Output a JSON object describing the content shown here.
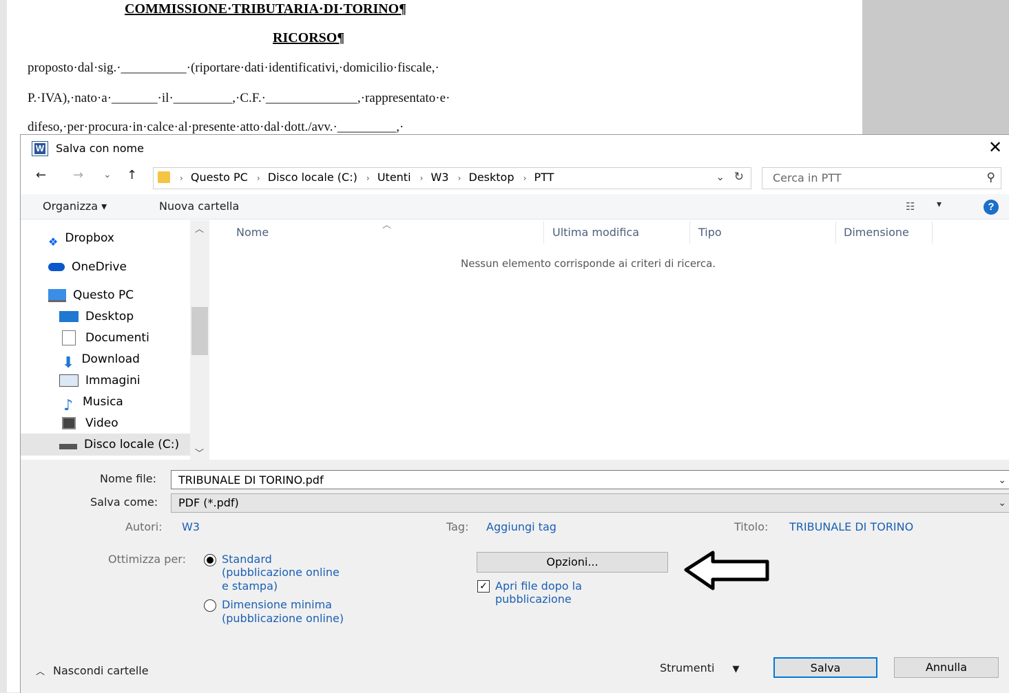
{
  "document": {
    "heading1": "COMMISSIONE·TRIBUTARIA·DI·TORINO¶",
    "heading2": "RICORSO¶",
    "line1": "proposto·dal·sig.·__________·(riportare·dati·identificativi,·domicilio·fiscale,·",
    "line2": "P.·IVA),·nato·a·_______·il·_________,·C.F.·______________,·rappresentato·e·",
    "line3": "difeso,·per·procura·in·calce·al·presente·atto·dal·dott./avv.·_________,·"
  },
  "dialog": {
    "title": "Salva con nome",
    "app_icon_letter": "W",
    "close_glyph": "✕"
  },
  "nav": {
    "back": "←",
    "forward": "→",
    "recent": "⌄",
    "up": "↑",
    "breadcrumb": [
      "Questo PC",
      "Disco locale (C:)",
      "Utenti",
      "W3",
      "Desktop",
      "PTT"
    ],
    "search_placeholder": "Cerca in PTT"
  },
  "toolbar": {
    "organize": "Organizza ▾",
    "new_folder": "Nuova cartella"
  },
  "sidebar": {
    "items": [
      {
        "label": "Dropbox",
        "icon": "dropbox-icon"
      },
      {
        "label": "OneDrive",
        "icon": "onedrive-icon"
      },
      {
        "label": "Questo PC",
        "icon": "computer-icon"
      },
      {
        "label": "Desktop",
        "icon": "desktop-icon"
      },
      {
        "label": "Documenti",
        "icon": "documents-icon"
      },
      {
        "label": "Download",
        "icon": "download-icon"
      },
      {
        "label": "Immagini",
        "icon": "pictures-icon"
      },
      {
        "label": "Musica",
        "icon": "music-icon"
      },
      {
        "label": "Video",
        "icon": "video-icon"
      },
      {
        "label": "Disco locale (C:)",
        "icon": "drive-icon"
      }
    ]
  },
  "filelist": {
    "columns": [
      "Nome",
      "Ultima modifica",
      "Tipo",
      "Dimensione"
    ],
    "empty_message": "Nessun elemento corrisponde ai criteri di ricerca."
  },
  "form": {
    "filename_label": "Nome file:",
    "filename_value": "TRIBUNALE DI TORINO.pdf",
    "savetype_label": "Salva come:",
    "savetype_value": "PDF (*.pdf)",
    "authors_label": "Autori:",
    "authors_value": "W3",
    "tag_label": "Tag:",
    "tag_value": "Aggiungi tag",
    "title_label": "Titolo:",
    "title_value": "TRIBUNALE DI TORINO",
    "optimize_label": "Ottimizza per:",
    "opt_standard_1": "Standard",
    "opt_standard_2": "(pubblicazione online",
    "opt_standard_3": "e stampa)",
    "opt_min_1": "Dimensione minima",
    "opt_min_2": "(pubblicazione online)",
    "options_button": "Opzioni...",
    "open_after_1": "Apri file dopo la",
    "open_after_2": "pubblicazione"
  },
  "footer": {
    "hide_folders": "Nascondi cartelle",
    "tools": "Strumenti",
    "save": "Salva",
    "cancel": "Annulla"
  },
  "colors": {
    "accent": "#0078d7",
    "link": "#1a5fb4"
  }
}
